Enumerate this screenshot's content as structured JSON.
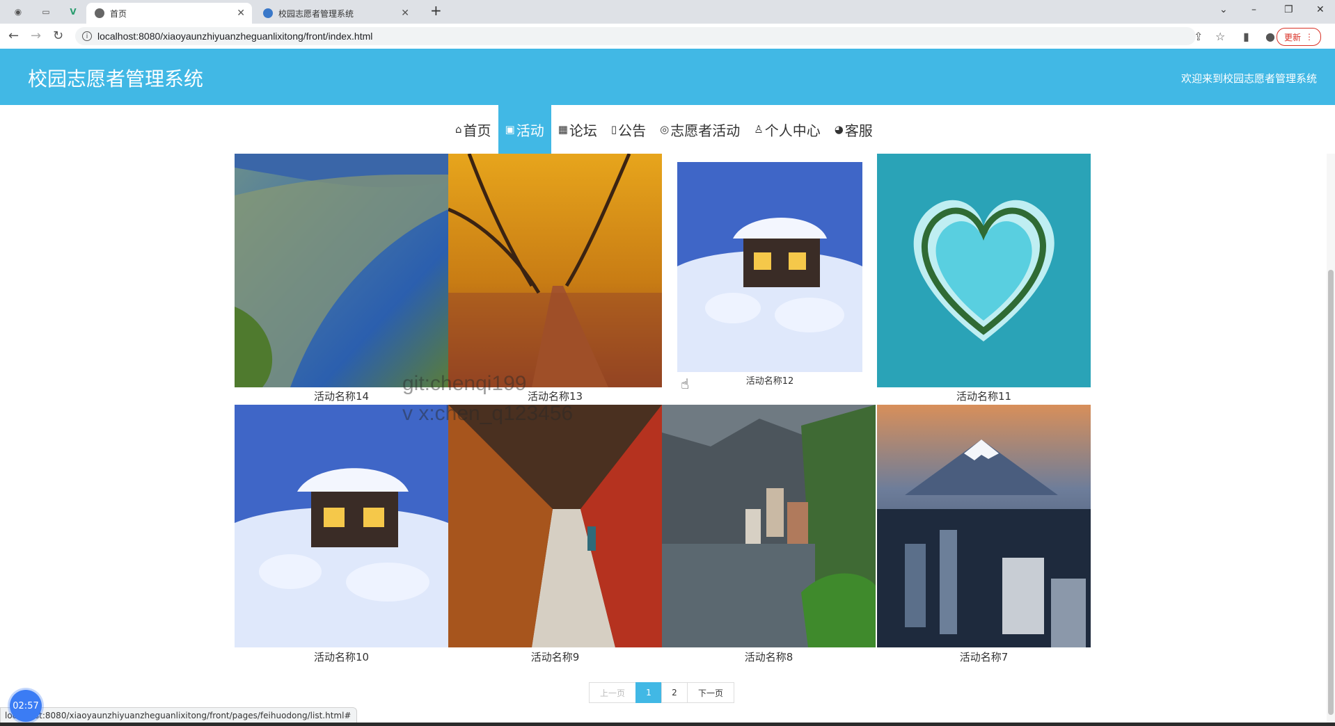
{
  "browser": {
    "tabs": [
      {
        "title": "首页"
      },
      {
        "title": "校园志愿者管理系统"
      }
    ],
    "url": "localhost:8080/xiaoyaunzhiyuanzheguanlixitong/front/index.html",
    "update_label": "更新",
    "status_url": "localhost:8080/xiaoyaunzhiyuanzheguanlixitong/front/pages/feihuodong/list.html#"
  },
  "header": {
    "title": "校园志愿者管理系统",
    "welcome": "欢迎来到校园志愿者管理系统"
  },
  "nav": {
    "items": [
      {
        "icon": "home-icon",
        "label": "首页"
      },
      {
        "icon": "gift-icon",
        "label": "活动"
      },
      {
        "icon": "grid-icon",
        "label": "论坛"
      },
      {
        "icon": "notice-icon",
        "label": "公告"
      },
      {
        "icon": "palette-icon",
        "label": "志愿者活动"
      },
      {
        "icon": "user-icon",
        "label": "个人中心"
      },
      {
        "icon": "service-icon",
        "label": "客服"
      }
    ],
    "active": "活动"
  },
  "activities": [
    {
      "name": "活动名称14",
      "image": "coastline-image"
    },
    {
      "name": "活动名称13",
      "image": "autumn-avenue-image"
    },
    {
      "name": "活动名称12",
      "image": "snow-cabin-image"
    },
    {
      "name": "活动名称11",
      "image": "heart-island-image"
    },
    {
      "name": "活动名称10",
      "image": "snow-cabin-image"
    },
    {
      "name": "活动名称9",
      "image": "red-corridor-image"
    },
    {
      "name": "活动名称8",
      "image": "lake-village-image"
    },
    {
      "name": "活动名称7",
      "image": "mount-fuji-city-image"
    }
  ],
  "watermark": {
    "line1": "git:chenqi199",
    "line2": "v x:chen_q123456"
  },
  "pagination": {
    "prev": "上一页",
    "pages": [
      "1",
      "2"
    ],
    "current": "1",
    "next": "下一页"
  },
  "timer": "02:57",
  "colors": {
    "primary": "#41b8e5"
  }
}
